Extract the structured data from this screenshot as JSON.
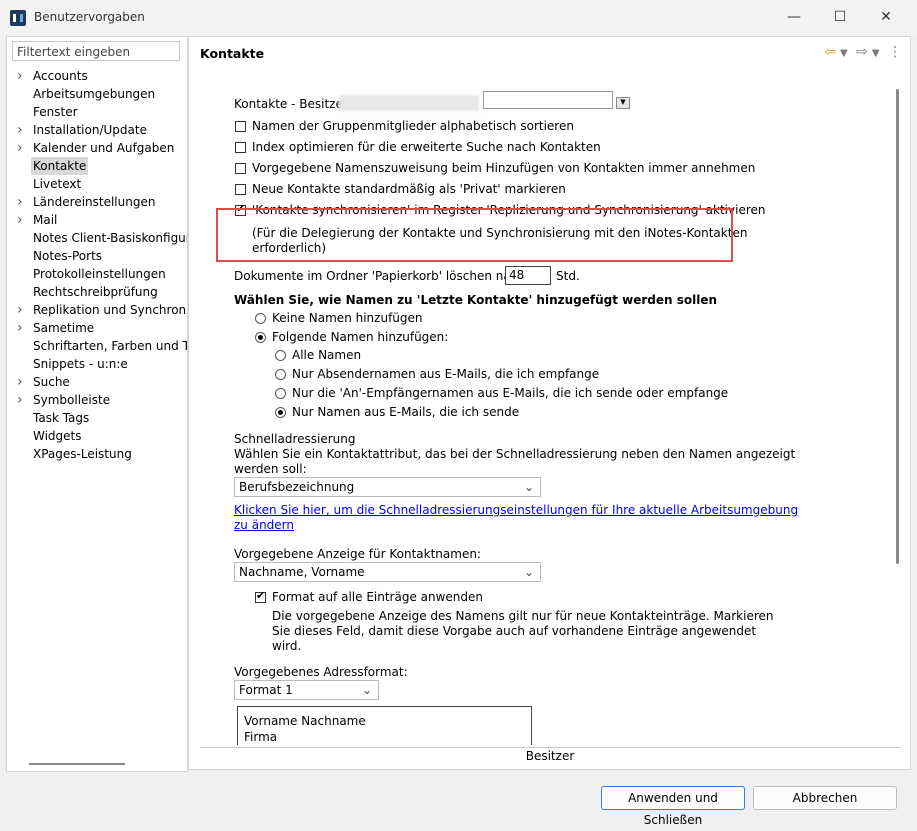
{
  "window": {
    "title": "Benutzervorgaben"
  },
  "filter": {
    "placeholder": "Filtertext eingeben"
  },
  "tree": [
    {
      "label": "Accounts",
      "expandable": true
    },
    {
      "label": "Arbeitsumgebungen",
      "expandable": false
    },
    {
      "label": "Fenster",
      "expandable": false
    },
    {
      "label": "Installation/Update",
      "expandable": true
    },
    {
      "label": "Kalender und Aufgaben",
      "expandable": true
    },
    {
      "label": "Kontakte",
      "expandable": false,
      "selected": true
    },
    {
      "label": "Livetext",
      "expandable": false
    },
    {
      "label": "Ländereinstellungen",
      "expandable": true
    },
    {
      "label": "Mail",
      "expandable": true
    },
    {
      "label": "Notes Client-Basiskonfigura",
      "expandable": false
    },
    {
      "label": "Notes-Ports",
      "expandable": false
    },
    {
      "label": "Protokolleinstellungen",
      "expandable": false
    },
    {
      "label": "Rechtschreibprüfung",
      "expandable": false
    },
    {
      "label": "Replikation und Synchronis",
      "expandable": true
    },
    {
      "label": "Sametime",
      "expandable": true
    },
    {
      "label": "Schriftarten, Farben und Th",
      "expandable": false
    },
    {
      "label": "Snippets - u:n:e",
      "expandable": false
    },
    {
      "label": "Suche",
      "expandable": true
    },
    {
      "label": "Symbolleiste",
      "expandable": true
    },
    {
      "label": "Task Tags",
      "expandable": false
    },
    {
      "label": "Widgets",
      "expandable": false
    },
    {
      "label": "XPages-Leistung",
      "expandable": false
    }
  ],
  "panel": {
    "title": "Kontakte",
    "owner_label": "Kontakte - Besitzer",
    "checkboxes": [
      {
        "label": "Namen der Gruppenmitglieder alphabetisch sortieren",
        "checked": false
      },
      {
        "label": "Index optimieren für die erweiterte Suche nach Kontakten",
        "checked": false
      },
      {
        "label": "Vorgegebene Namenszuweisung beim Hinzufügen von Kontakten immer annehmen",
        "checked": false
      },
      {
        "label": "Neue Kontakte standardmäßig als 'Privat' markieren",
        "checked": false
      },
      {
        "label": "'Kontakte synchronisieren' im Register 'Replizierung und Synchronisierung' aktivieren",
        "checked": true
      }
    ],
    "sync_note_line1": "(Für die Delegierung der Kontakte und Synchronisierung mit den iNotes-Kontakten",
    "sync_note_line2": "erforderlich)",
    "trash_label_before": "Dokumente im Ordner 'Papierkorb' löschen nach",
    "trash_days": "48",
    "trash_label_after": "Std.",
    "recent_heading": "Wählen Sie, wie Namen zu 'Letzte Kontakte' hinzugefügt werden sollen",
    "radio_none": "Keine Namen hinzufügen",
    "radio_following": "Folgende Namen hinzufügen:",
    "sub_radios": [
      {
        "label": "Alle Namen",
        "checked": false
      },
      {
        "label": "Nur Absendernamen aus E-Mails, die ich empfange",
        "checked": false
      },
      {
        "label": "Nur die 'An'-Empfängernamen aus E-Mails, die ich sende oder empfange",
        "checked": false
      },
      {
        "label": "Nur Namen aus E-Mails, die ich sende",
        "checked": true
      }
    ],
    "quick_heading": "Schnelladressierung",
    "quick_desc_line1": "Wählen Sie ein Kontaktattribut, das bei der Schnelladressierung neben den Namen angezeigt",
    "quick_desc_line2": "werden soll:",
    "quick_select": "Berufsbezeichnung",
    "quick_link_line1": "Klicken Sie hier, um die Schnelladressierungseinstellungen für Ihre aktuelle Arbeitsumgebung",
    "quick_link_line2": "zu ändern",
    "display_label": "Vorgegebene Anzeige für Kontaktnamen:",
    "display_select": "Nachname, Vorname",
    "apply_all_label": "Format auf alle Einträge anwenden",
    "apply_all_desc1": "Die vorgegebene Anzeige des Namens gilt nur für neue Kontakteinträge. Markieren",
    "apply_all_desc2": "Sie dieses Feld, damit diese Vorgabe auch auf vorhandene Einträge angewendet",
    "apply_all_desc3": "wird.",
    "address_label": "Vorgegebenes Adressformat:",
    "address_select": "Format 1",
    "address_preview_line1": "Vorname Nachname",
    "address_preview_line2": "Firma",
    "bottom_label": "Besitzer"
  },
  "buttons": {
    "apply": "Anwenden und Schließen",
    "cancel": "Abbrechen"
  },
  "colors": {
    "highlight_border": "#e34b4b",
    "primary_border": "#3a7bd5",
    "link": "#0000ee"
  }
}
